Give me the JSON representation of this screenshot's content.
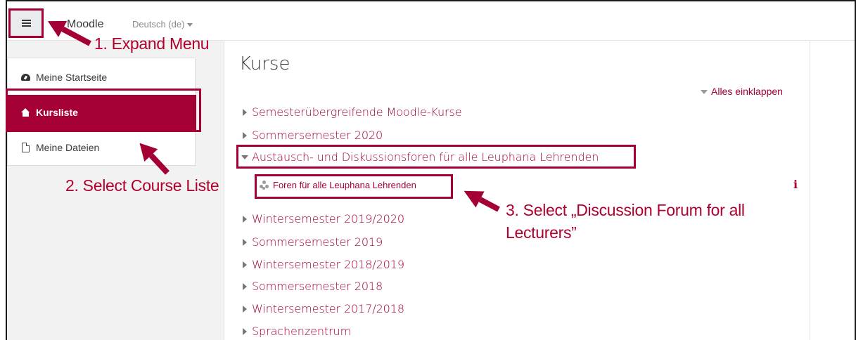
{
  "navbar": {
    "brand": "Moodle",
    "language": "Deutsch (de)"
  },
  "sidebar": {
    "items": [
      {
        "label": "Meine Startseite",
        "icon": "dashboard-icon",
        "active": false
      },
      {
        "label": "Kursliste",
        "icon": "home-icon",
        "active": true
      },
      {
        "label": "Meine Dateien",
        "icon": "file-icon",
        "active": false
      }
    ]
  },
  "main": {
    "title": "Kurse",
    "collapse_all": "Alles einklappen",
    "categories": [
      {
        "label": "Semesterübergreifende Moodle-Kurse",
        "expanded": false
      },
      {
        "label": "Sommersemester 2020",
        "expanded": false
      },
      {
        "label": "Austausch- und Diskussionsforen für alle Leuphana Lehrenden",
        "expanded": true
      },
      {
        "label": "Wintersemester 2019/2020",
        "expanded": false
      },
      {
        "label": "Sommersemester 2019",
        "expanded": false
      },
      {
        "label": "Wintersemester 2018/2019",
        "expanded": false
      },
      {
        "label": "Sommersemester 2018",
        "expanded": false
      },
      {
        "label": "Wintersemester 2017/2018",
        "expanded": false
      },
      {
        "label": "Sprachenzentrum",
        "expanded": false
      }
    ],
    "course": {
      "label": "Foren für alle Leuphana Lehrenden",
      "info": "i"
    }
  },
  "annotations": {
    "step1": "1. Expand Menu",
    "step2": "2. Select Course Liste",
    "step3_line1": "3. Select „Discussion Forum for all",
    "step3_line2": "Lecturers”"
  },
  "colors": {
    "accent": "#a50034",
    "annotation": "#b0002e",
    "background": "#f2f2f2"
  }
}
